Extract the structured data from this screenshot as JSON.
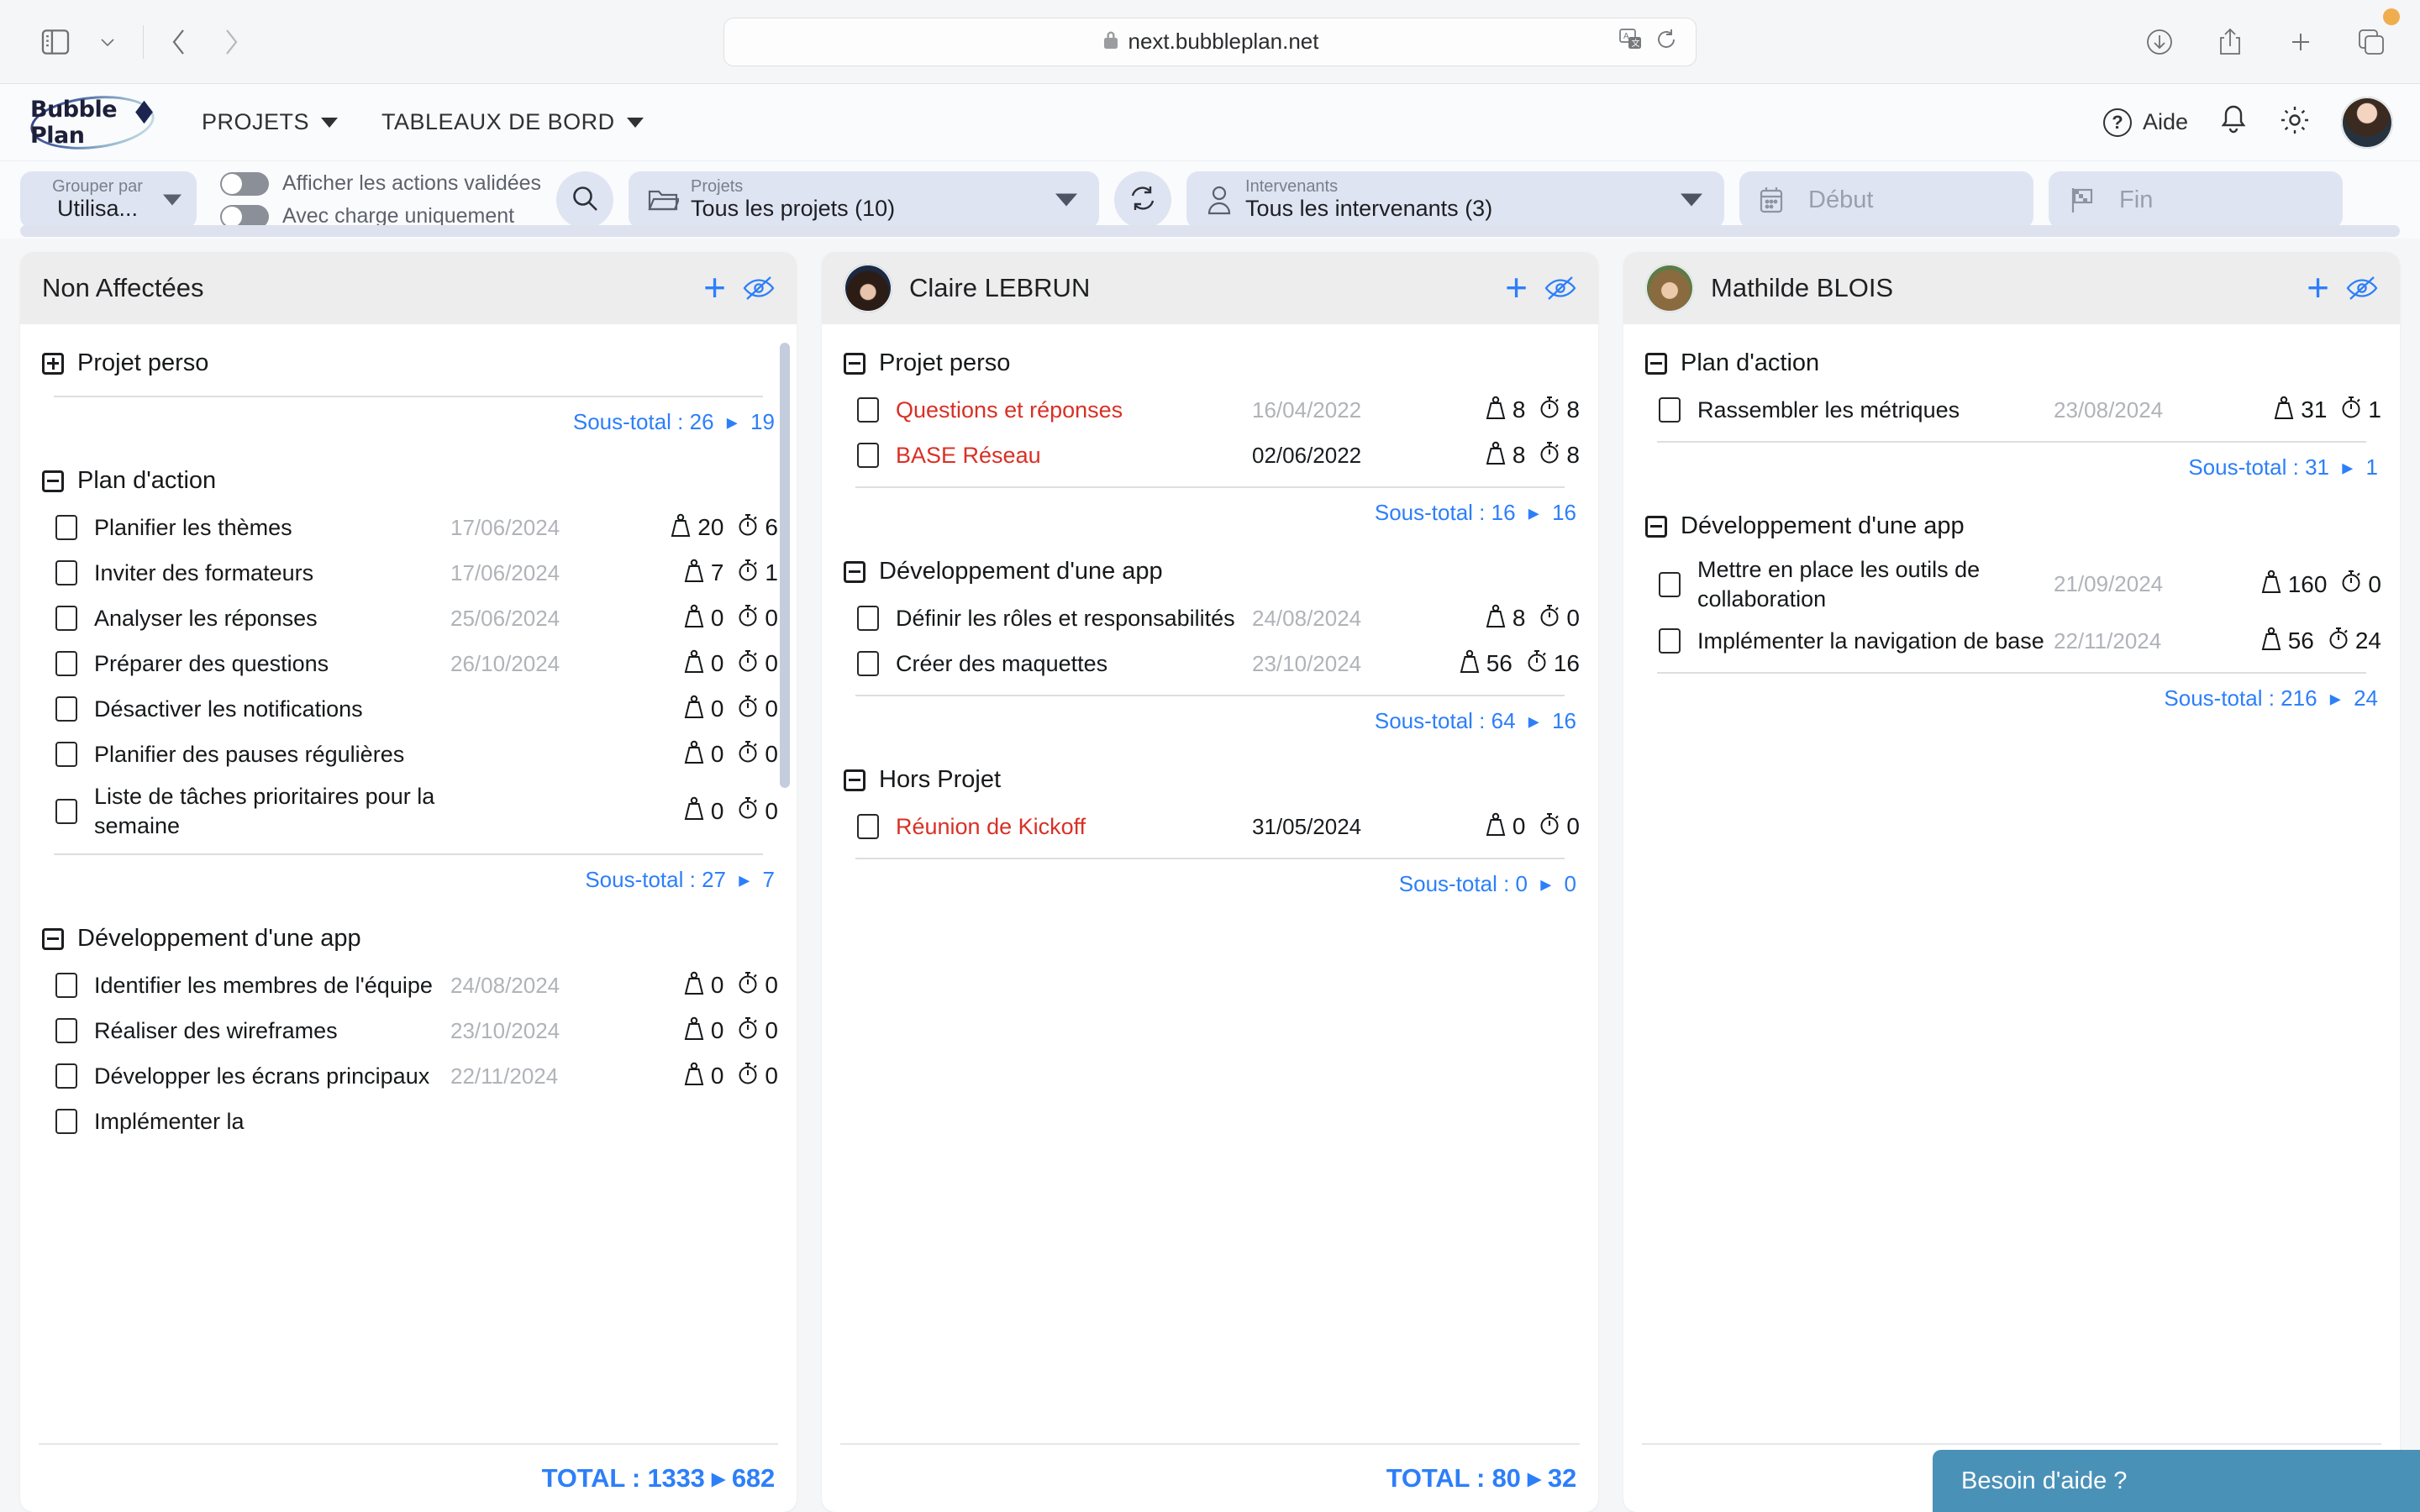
{
  "browser": {
    "url": "next.bubbleplan.net",
    "icons": {
      "sidebar": "sidebar-toggle-icon",
      "chevron": "chevron-down-icon",
      "back": "back-arrow-icon",
      "forward": "forward-arrow-icon",
      "lock": "lock-icon",
      "translate": "translate-icon",
      "reload": "reload-icon",
      "download": "download-icon",
      "share": "share-icon",
      "newtab": "plus-icon",
      "tabs": "tabs-icon"
    }
  },
  "app_header": {
    "logo_text": "Bubble Plan",
    "nav": [
      {
        "label": "PROJETS"
      },
      {
        "label": "TABLEAUX DE BORD"
      }
    ],
    "help_label": "Aide",
    "icons": {
      "help": "question-circle-icon",
      "bell": "bell-icon",
      "gear": "gear-icon",
      "avatar": "user-avatar"
    }
  },
  "filter_bar": {
    "group_by": {
      "label": "Grouper par",
      "value": "Utilisa..."
    },
    "toggles": [
      {
        "label": "Afficher les actions validées",
        "on": false
      },
      {
        "label": "Avec charge uniquement",
        "on": false
      }
    ],
    "search_icon": "search-icon",
    "projects": {
      "label": "Projets",
      "value": "Tous les projets (10)",
      "icon": "folder-icon"
    },
    "refresh_icon": "refresh-icon",
    "intervenants": {
      "label": "Intervenants",
      "value": "Tous les intervenants (3)",
      "icon": "person-icon"
    },
    "start_date": {
      "placeholder": "Début",
      "icon": "calendar-icon"
    },
    "end_date": {
      "placeholder": "Fin",
      "icon": "flag-icon"
    }
  },
  "colors": {
    "accent_blue": "#2d7ff9",
    "overdue_red": "#d93025",
    "pill_bg": "#dfe4f2",
    "header_bg": "#ededee",
    "help_widget": "#4a91b8"
  },
  "columns": [
    {
      "title": "Non Affectées",
      "has_avatar": false,
      "add_label": "+",
      "hide_icon": "eye-off-icon",
      "groups": [
        {
          "name": "Projet perso",
          "expanded": false,
          "tasks": [],
          "subtotal": {
            "label": "Sous-total :",
            "charge": "26",
            "time": "19"
          }
        },
        {
          "name": "Plan d'action",
          "expanded": true,
          "tasks": [
            {
              "name": "Planifier les thèmes",
              "date": "17/06/2024",
              "charge": "20",
              "time": "6",
              "overdue": false,
              "date_dark": false
            },
            {
              "name": "Inviter des formateurs",
              "date": "17/06/2024",
              "charge": "7",
              "time": "1",
              "overdue": false,
              "date_dark": false
            },
            {
              "name": "Analyser les réponses",
              "date": "25/06/2024",
              "charge": "0",
              "time": "0",
              "overdue": false,
              "date_dark": false
            },
            {
              "name": "Préparer des questions",
              "date": "26/10/2024",
              "charge": "0",
              "time": "0",
              "overdue": false,
              "date_dark": false
            },
            {
              "name": "Désactiver les notifications",
              "date": "",
              "charge": "0",
              "time": "0",
              "overdue": false,
              "date_dark": false
            },
            {
              "name": "Planifier des pauses régulières",
              "date": "",
              "charge": "0",
              "time": "0",
              "overdue": false,
              "date_dark": false
            },
            {
              "name": "Liste de tâches prioritaires pour la semaine",
              "date": "",
              "charge": "0",
              "time": "0",
              "overdue": false,
              "date_dark": false
            }
          ],
          "subtotal": {
            "label": "Sous-total :",
            "charge": "27",
            "time": "7"
          }
        },
        {
          "name": "Développement d'une app",
          "expanded": true,
          "tasks": [
            {
              "name": "Identifier les membres de l'équipe",
              "date": "24/08/2024",
              "charge": "0",
              "time": "0",
              "overdue": false,
              "date_dark": false
            },
            {
              "name": "Réaliser des wireframes",
              "date": "23/10/2024",
              "charge": "0",
              "time": "0",
              "overdue": false,
              "date_dark": false
            },
            {
              "name": "Développer les écrans principaux",
              "date": "22/11/2024",
              "charge": "0",
              "time": "0",
              "overdue": false,
              "date_dark": false
            },
            {
              "name": "Implémenter la",
              "date": "",
              "charge": "",
              "time": "",
              "overdue": false,
              "date_dark": false,
              "clipped": true
            }
          ],
          "subtotal": null
        }
      ],
      "total": {
        "label": "TOTAL :",
        "charge": "1333",
        "time": "682"
      }
    },
    {
      "title": "Claire LEBRUN",
      "has_avatar": true,
      "avatar_class": "claire",
      "add_label": "+",
      "hide_icon": "eye-off-icon",
      "groups": [
        {
          "name": "Projet perso",
          "expanded": true,
          "tasks": [
            {
              "name": "Questions et réponses",
              "date": "16/04/2022",
              "charge": "8",
              "time": "8",
              "overdue": true,
              "date_dark": false
            },
            {
              "name": "BASE Réseau",
              "date": "02/06/2022",
              "charge": "8",
              "time": "8",
              "overdue": true,
              "date_dark": true
            }
          ],
          "subtotal": {
            "label": "Sous-total :",
            "charge": "16",
            "time": "16"
          }
        },
        {
          "name": "Développement d'une app",
          "expanded": true,
          "tasks": [
            {
              "name": "Définir les rôles et responsabilités",
              "date": "24/08/2024",
              "charge": "8",
              "time": "0",
              "overdue": false,
              "date_dark": false
            },
            {
              "name": "Créer des maquettes",
              "date": "23/10/2024",
              "charge": "56",
              "time": "16",
              "overdue": false,
              "date_dark": false
            }
          ],
          "subtotal": {
            "label": "Sous-total :",
            "charge": "64",
            "time": "16"
          }
        },
        {
          "name": "Hors Projet",
          "expanded": true,
          "tasks": [
            {
              "name": "Réunion de Kickoff",
              "date": "31/05/2024",
              "charge": "0",
              "time": "0",
              "overdue": true,
              "date_dark": true
            }
          ],
          "subtotal": {
            "label": "Sous-total :",
            "charge": "0",
            "time": "0"
          }
        }
      ],
      "total": {
        "label": "TOTAL :",
        "charge": "80",
        "time": "32"
      }
    },
    {
      "title": "Mathilde BLOIS",
      "has_avatar": true,
      "avatar_class": "mathilde",
      "add_label": "+",
      "hide_icon": "eye-off-icon",
      "groups": [
        {
          "name": "Plan d'action",
          "expanded": true,
          "tasks": [
            {
              "name": "Rassembler les métriques",
              "date": "23/08/2024",
              "charge": "31",
              "time": "1",
              "overdue": false,
              "date_dark": false
            }
          ],
          "subtotal": {
            "label": "Sous-total :",
            "charge": "31",
            "time": "1"
          }
        },
        {
          "name": "Développement d'une app",
          "expanded": true,
          "tasks": [
            {
              "name": "Mettre en place les outils de collaboration",
              "date": "21/09/2024",
              "charge": "160",
              "time": "0",
              "overdue": false,
              "date_dark": false
            },
            {
              "name": "Implémenter la navigation de base",
              "date": "22/11/2024",
              "charge": "56",
              "time": "24",
              "overdue": false,
              "date_dark": false
            }
          ],
          "subtotal": {
            "label": "Sous-total :",
            "charge": "216",
            "time": "24"
          }
        }
      ],
      "total": null
    }
  ],
  "help_widget": {
    "label": "Besoin d'aide ?"
  }
}
